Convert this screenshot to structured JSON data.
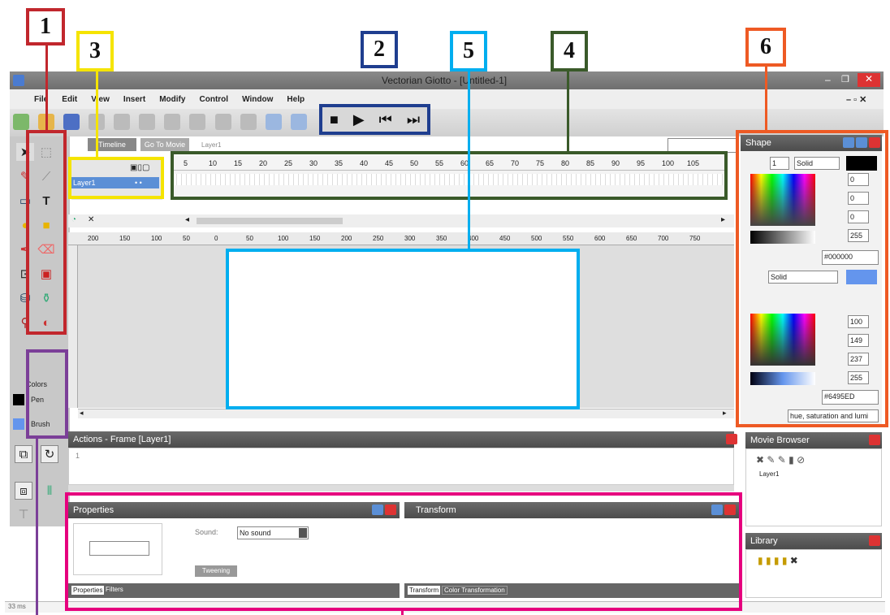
{
  "window": {
    "title": "Vectorian Giotto - [Untitled-1]"
  },
  "menu": [
    "File",
    "Edit",
    "View",
    "Insert",
    "Modify",
    "Control",
    "Window",
    "Help"
  ],
  "tabs": {
    "timeline": "Timeline",
    "go_to_movie": "Go To Movie",
    "layer_label": "Layer1"
  },
  "timeline": {
    "layer_name": "Layer1",
    "frame_numbers": [
      "5",
      "10",
      "15",
      "20",
      "25",
      "30",
      "35",
      "40",
      "45",
      "50",
      "55",
      "60",
      "65",
      "70",
      "75",
      "80",
      "85",
      "90",
      "95",
      "100",
      "105"
    ]
  },
  "ruler_marks": [
    "200",
    "150",
    "100",
    "50",
    "0",
    "50",
    "100",
    "150",
    "200",
    "250",
    "300",
    "350",
    "400",
    "450",
    "500",
    "550",
    "600",
    "650",
    "700",
    "750"
  ],
  "toolbox": {
    "colors_label": "Colors",
    "pen_label": "Pen",
    "brush_label": "Brush"
  },
  "actions": {
    "title": "Actions - Frame [Layer1]",
    "line_number": "1"
  },
  "properties": {
    "title": "Properties",
    "sound_label": "Sound:",
    "sound_value": "No sound",
    "tab_properties": "Properties",
    "tab_filters": "Filters",
    "button_label": "Tweening"
  },
  "transform": {
    "title": "Transform",
    "tab_transform": "Transform",
    "tab_color": "Color Transformation"
  },
  "shape_panel": {
    "title": "Shape",
    "line_size": "1",
    "line_style": "Solid",
    "fill_style": "Solid",
    "rgb_top": [
      "0",
      "0",
      "0",
      "255"
    ],
    "hex_top": "#000000",
    "rgb_bottom": [
      "100",
      "149",
      "237",
      "255"
    ],
    "hex_bottom": "#6495ED",
    "color_mode": "hue, saturation and lumi"
  },
  "movie_browser": {
    "title": "Movie Browser",
    "item": "Layer1"
  },
  "library": {
    "title": "Library"
  },
  "status": {
    "left": "33 ms"
  },
  "callouts": [
    "1",
    "2",
    "3",
    "4",
    "5",
    "6"
  ],
  "colors": {
    "c1": "#c1272d",
    "c2": "#1f3e8f",
    "c3": "#f5e400",
    "c4": "#3a5a2a",
    "c5": "#00aeef",
    "c6": "#ee5a24",
    "purple": "#7b3f98",
    "magenta": "#e6007e",
    "accent": "#6495ED"
  }
}
